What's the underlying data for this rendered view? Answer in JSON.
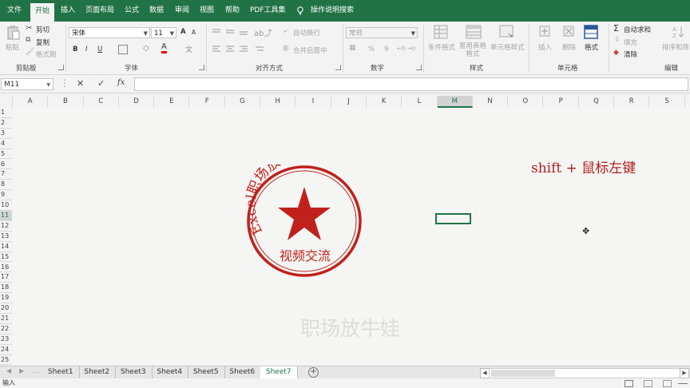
{
  "menu": {
    "tabs": [
      "文件",
      "开始",
      "插入",
      "页面布局",
      "公式",
      "数据",
      "审阅",
      "视图",
      "帮助",
      "PDF工具集"
    ],
    "active_tab": "开始",
    "tell_me": "操作说明搜索"
  },
  "ribbon": {
    "clipboard": {
      "paste": "粘贴",
      "cut": "剪切",
      "copy": "复制",
      "format_painter": "格式刷",
      "label": "剪贴板"
    },
    "font": {
      "name": "宋体",
      "size": "11",
      "bold": "B",
      "italic": "I",
      "underline": "U",
      "grow": "A",
      "shrink": "A",
      "label": "字体"
    },
    "alignment": {
      "wrap": "自动换行",
      "merge": "合并后居中",
      "label": "对齐方式"
    },
    "number": {
      "format": "常规",
      "percent": "%",
      "comma": "9",
      "label": "数字"
    },
    "styles": {
      "conditional": "条件格式",
      "table": "套用表格格式",
      "cell_styles": "单元格样式",
      "label": "样式"
    },
    "cells": {
      "insert": "插入",
      "delete": "删除",
      "format": "格式",
      "label": "单元格"
    },
    "editing": {
      "autosum": "自动求和",
      "fill": "填充",
      "clear": "清除",
      "sort": "排序和筛",
      "label": "编辑"
    }
  },
  "formula_bar": {
    "name_box": "M11",
    "fx": "fx",
    "cancel": "✕",
    "enter": "✓",
    "value": ""
  },
  "grid": {
    "columns": [
      "A",
      "B",
      "C",
      "D",
      "E",
      "F",
      "G",
      "H",
      "I",
      "J",
      "K",
      "L",
      "M",
      "N",
      "O",
      "P",
      "Q",
      "R",
      "S"
    ],
    "selected_column": "M",
    "rows": [
      "1",
      "2",
      "3",
      "4",
      "5",
      "6",
      "7",
      "8",
      "9",
      "10",
      "11",
      "12",
      "13",
      "14",
      "15",
      "16",
      "17",
      "18",
      "19",
      "20",
      "21",
      "22",
      "23",
      "24",
      "25"
    ],
    "selected_row": "11"
  },
  "stamp": {
    "arc_text": "Excel职场放牛娃",
    "bottom_text": "视频交流",
    "color": "#c0211d"
  },
  "annotation": "shift + 鼠标左键",
  "watermark": "职场放牛娃",
  "sheet_tabs": [
    "Sheet1",
    "Sheet2",
    "Sheet3",
    "Sheet4",
    "Sheet5",
    "Sheet6",
    "Sheet7"
  ],
  "active_sheet": "Sheet7",
  "status": {
    "mode": "输入"
  },
  "colors": {
    "accent": "#217346",
    "stamp_red": "#c0211d"
  }
}
